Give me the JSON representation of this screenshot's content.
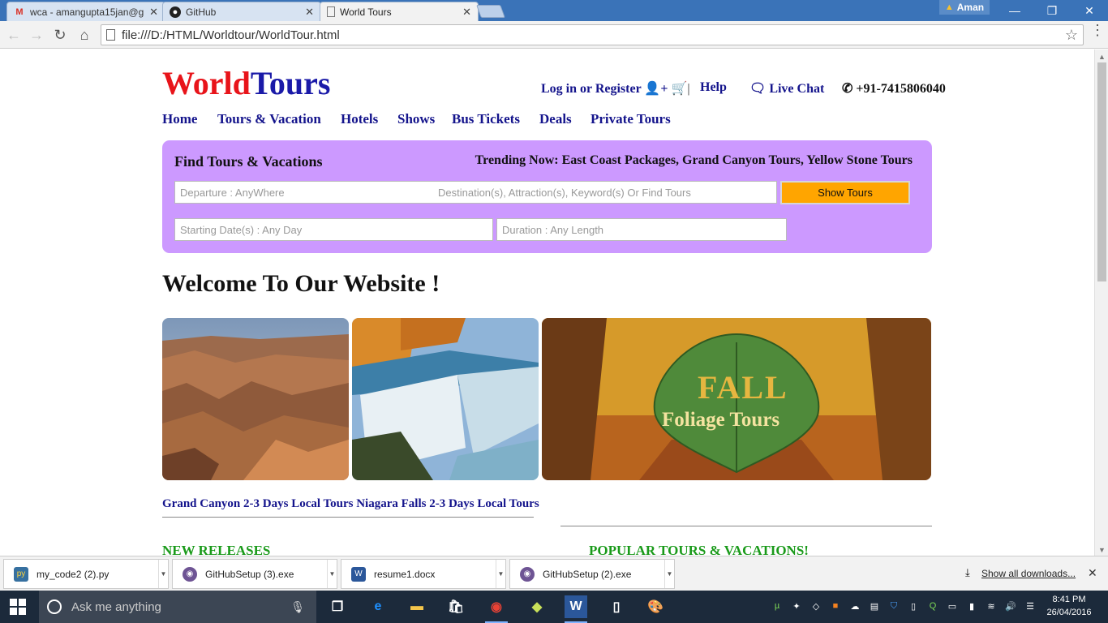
{
  "browser": {
    "tabs": [
      {
        "title": "wca - amangupta15jan@g",
        "icon": "gmail-icon"
      },
      {
        "title": "GitHub",
        "icon": "github-icon"
      },
      {
        "title": "World Tours",
        "icon": "page-icon"
      }
    ],
    "profile_name": "Aman",
    "url": "file:///D:/HTML/Worldtour/WorldTour.html"
  },
  "site": {
    "logo_part1": "World",
    "logo_part2": "Tours",
    "login": "Log in or Register",
    "help": "Help",
    "live_chat": "Live Chat",
    "phone": "+91-7415806040",
    "nav": [
      "Home",
      "Tours & Vacation",
      "Hotels",
      "Shows",
      "Bus Tickets",
      "Deals",
      "Private Tours"
    ],
    "search": {
      "title": "Find Tours & Vacations",
      "trending": "Trending Now: East Coast Packages, Grand Canyon Tours, Yellow Stone Tours",
      "departure_placeholder": "Departure : AnyWhere",
      "destination_placeholder": "Destination(s), Attraction(s), Keyword(s) Or Find Tours",
      "show_button": "Show Tours",
      "date_placeholder": "Starting Date(s) : Any Day",
      "duration_placeholder": "Duration : Any Length"
    },
    "welcome": "Welcome To Our Website !",
    "banner_text_1": "FALL",
    "banner_text_2": "Foliage Tours",
    "tour_links": [
      "Grand Canyon 2-3 Days Local Tours",
      "Niagara Falls 2-3 Days Local Tours"
    ],
    "new_releases": "NEW RELEASES",
    "popular": "POPULAR TOURS & VACATIONS!"
  },
  "downloads": {
    "items": [
      "my_code2 (2).py",
      "GitHubSetup (3).exe",
      "resume1.docx",
      "GitHubSetup (2).exe"
    ],
    "show_all": "Show all downloads..."
  },
  "taskbar": {
    "search_placeholder": "Ask me anything",
    "time": "8:41 PM",
    "date": "26/04/2016"
  },
  "colors": {
    "logo_red": "#e8141a",
    "logo_blue": "#1a1aa8",
    "panel": "#cc99ff",
    "button_orange": "#ffa500",
    "section_green": "#1a9a1a"
  }
}
